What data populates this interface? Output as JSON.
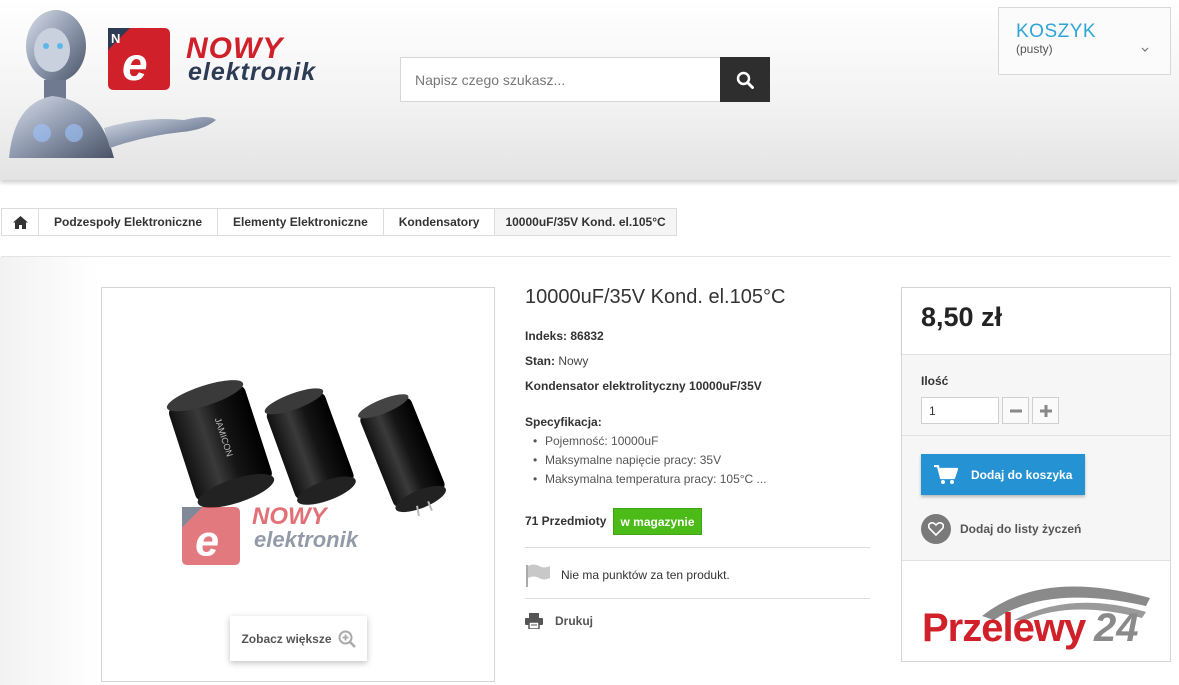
{
  "header": {
    "logo": {
      "word1": "NOWY",
      "word2": "elektronik",
      "badge_letters": "N e",
      "icon": "nowy-elektronik-logo"
    },
    "mascot_icon": "robot-mascot",
    "search": {
      "placeholder": "Napisz czego szukasz...",
      "value": "",
      "icon": "search-icon"
    },
    "cart": {
      "title": "KOSZYK",
      "status": "(pusty)",
      "icon": "chevron-down-icon"
    }
  },
  "breadcrumb": {
    "home_icon": "home-icon",
    "items": [
      "Podzespoły Elektroniczne",
      "Elementy Elektroniczne",
      "Kondensatory",
      "10000uF/35V Kond. el.105°C"
    ]
  },
  "product": {
    "title": "10000uF/35V Kond. el.105°C",
    "index_label": "Indeks:",
    "index_value": "86832",
    "condition_label": "Stan:",
    "condition_value": "Nowy",
    "short_description": "Kondensator elektrolityczny 10000uF/35V",
    "spec_title": "Specyfikacja:",
    "specs": [
      "Pojemność: 10000uF",
      "Maksymalne napięcie pracy: 35V",
      "Maksymalna temperatura pracy: 105°C ..."
    ],
    "stock_count": "71 Przedmioty",
    "stock_badge": "w magazynie",
    "points_text": "Nie ma punktów za ten produkt.",
    "print_label": "Drukuj",
    "zoom_label": "Zobacz większe",
    "image_watermark": {
      "word1": "NOWY",
      "word2": "elektronik"
    }
  },
  "buy_box": {
    "price": "8,50 zł",
    "qty_label": "Ilość",
    "qty_value": "1",
    "add_to_cart_label": "Dodaj do koszyka",
    "wishlist_label": "Dodaj do listy życzeń",
    "payment_logo": {
      "word1": "Przelewy",
      "word2": "24"
    }
  },
  "colors": {
    "accent_blue": "#2592d4",
    "cart_title": "#2fa4d8",
    "stock_green": "#4cbb17",
    "logo_red": "#d0202a",
    "logo_dark": "#2e3b55",
    "p24_red": "#d0202a",
    "p24_gray": "#8a8a8a"
  }
}
